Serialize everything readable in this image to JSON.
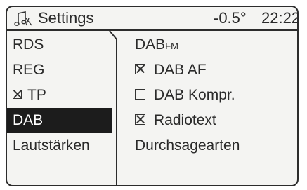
{
  "header": {
    "icon": "music-note-settings-icon",
    "title": "Settings",
    "temperature": "-0.5°",
    "time": "22:22"
  },
  "left_menu": {
    "items": [
      {
        "label": "RDS",
        "checkbox": null,
        "selected": false
      },
      {
        "label": "REG",
        "checkbox": null,
        "selected": false
      },
      {
        "label": "TP",
        "checkbox": true,
        "selected": false
      },
      {
        "label": "DAB",
        "checkbox": null,
        "selected": true
      },
      {
        "label": "Lautstärken",
        "checkbox": null,
        "selected": false
      }
    ]
  },
  "right_panel": {
    "heading_main": "DAB",
    "heading_sub": "FM",
    "items": [
      {
        "label": "DAB AF",
        "checked": true
      },
      {
        "label": "DAB Kompr.",
        "checked": false
      },
      {
        "label": "Radiotext",
        "checked": true
      },
      {
        "label": "Durchsagearten",
        "checked": null
      }
    ]
  },
  "colors": {
    "frame": "#2c2c2c",
    "background": "#f4f4f2",
    "selected_bg": "#1c1c1c",
    "selected_fg": "#ffffff"
  }
}
